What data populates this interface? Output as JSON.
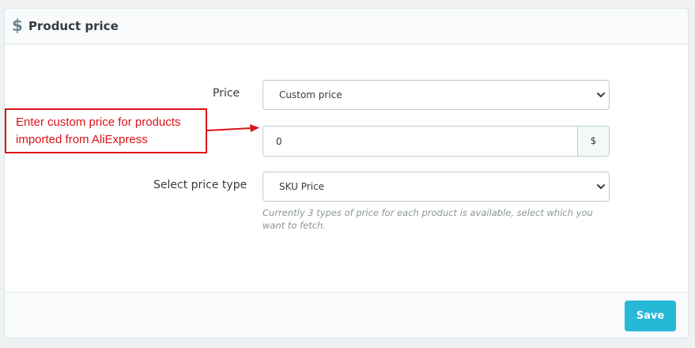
{
  "panel": {
    "icon": "dollar-icon",
    "title": "Product price"
  },
  "form": {
    "price_label": "Price",
    "price_selected": "Custom price",
    "custom_price_value": "0",
    "currency_symbol": "$",
    "price_type_label": "Select price type",
    "price_type_selected": "SKU Price",
    "price_type_help": "Currently 3 types of price for each product is available, select which you want to fetch."
  },
  "annotation": {
    "line1": "Enter custom price for products",
    "line2": "imported from AliExpress"
  },
  "footer": {
    "save_label": "Save"
  },
  "colors": {
    "accent": "#25b9d7",
    "annotation": "#d9131a"
  }
}
